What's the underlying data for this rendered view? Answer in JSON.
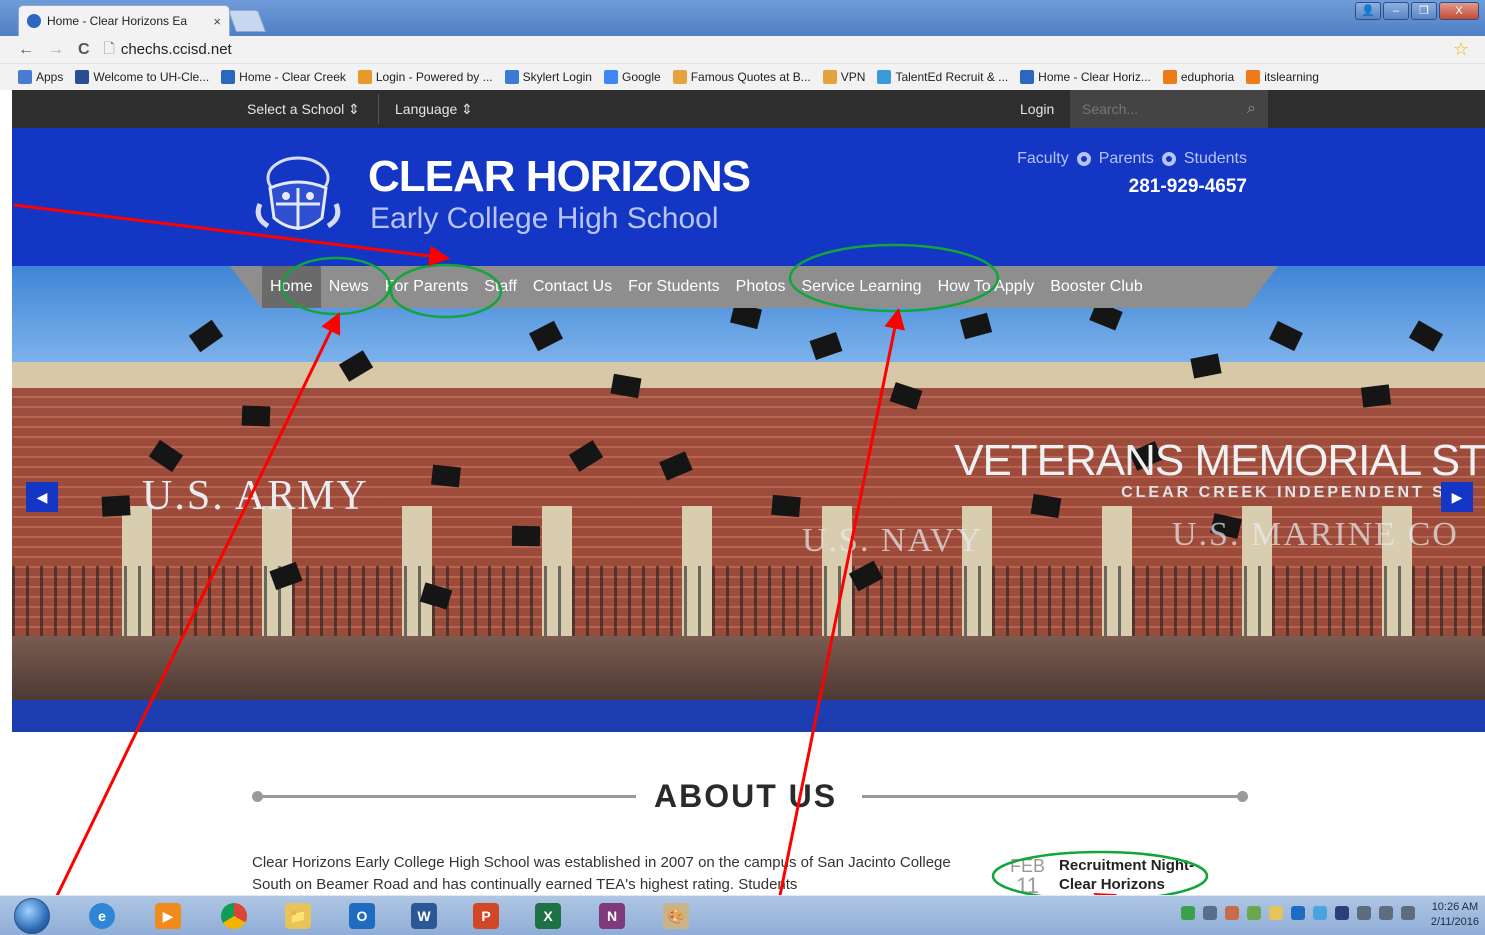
{
  "browser": {
    "tab_title": "Home - Clear Horizons Ea",
    "tab_close": "×",
    "url": "chechs.ccisd.net",
    "window_controls": [
      "👤",
      "–",
      "❐",
      "X"
    ]
  },
  "bookmarks": [
    {
      "label": "Apps",
      "icon": "apps-icon",
      "color": "#4a7bd4"
    },
    {
      "label": "Welcome to UH-Cle...",
      "icon": "uhcl-icon",
      "color": "#2a4e96"
    },
    {
      "label": "Home - Clear Creek",
      "icon": "ccisd-icon",
      "color": "#2b66c1"
    },
    {
      "label": "Login - Powered by ...",
      "icon": "login-icon",
      "color": "#e69a2c"
    },
    {
      "label": "Skylert Login",
      "icon": "skylert-icon",
      "color": "#3a7bd5"
    },
    {
      "label": "Google",
      "icon": "google-icon",
      "color": "#4285f4"
    },
    {
      "label": "Famous Quotes at B...",
      "icon": "quotes-icon",
      "color": "#e6a23c"
    },
    {
      "label": "VPN",
      "icon": "vpn-icon",
      "color": "#e6a23c"
    },
    {
      "label": "TalentEd Recruit & ...",
      "icon": "talented-icon",
      "color": "#3b9ad9"
    },
    {
      "label": "Home - Clear Horiz...",
      "icon": "ccisd-icon",
      "color": "#2b66c1"
    },
    {
      "label": "eduphoria",
      "icon": "eduphoria-icon",
      "color": "#ee7b18"
    },
    {
      "label": "itslearning",
      "icon": "itslearning-icon",
      "color": "#ee7b18"
    }
  ],
  "utility": {
    "select_school": "Select a School ⇕",
    "language": "Language ⇕",
    "login": "Login",
    "search_placeholder": "Search..."
  },
  "header": {
    "name": "CLEAR HORIZONS",
    "subtitle": "Early College High School",
    "audience": [
      "Faculty",
      "Parents",
      "Students"
    ],
    "phone": "281-929-4657"
  },
  "nav": [
    "Home",
    "News",
    "For Parents",
    "Staff",
    "Contact Us",
    "For Students",
    "Photos",
    "Service Learning",
    "How To Apply",
    "Booster Club"
  ],
  "nav_active": "Home",
  "hero": {
    "text_army": "U.S. ARMY",
    "text_navy": "U.S. NAVY",
    "text_marine": "U.S. MARINE CO",
    "text_memorial": "VETERANS MEMORIAL ST",
    "text_ccisd": "CLEAR CREEK INDEPENDENT SCH",
    "prev": "◀",
    "next": "▶"
  },
  "about": {
    "heading": "ABOUT US",
    "body": "Clear Horizons Early College High School was established in 2007 on the campus of San Jacinto College South on Beamer Road and has continually earned TEA's highest rating.  Students"
  },
  "event": {
    "month": "FEB",
    "day": "11",
    "title": "Recruitment Night- Clear Horizons"
  },
  "clock": {
    "time": "10:26 AM",
    "date": "2/11/2016"
  },
  "colors": {
    "brand_blue": "#1336c4",
    "nav_gray": "#8e8e8e",
    "annotation_red": "#ff0000",
    "annotation_green": "#11a53a"
  }
}
